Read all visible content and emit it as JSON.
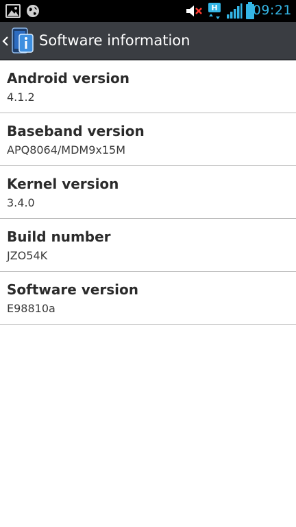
{
  "status_bar": {
    "time": "09:21",
    "network_type": "H",
    "accent_color": "#34b6e6",
    "left_icons": [
      "gallery-icon",
      "globe-icon"
    ],
    "right_icons": [
      "volume-mute-icon",
      "network-h-icon",
      "signal-icon",
      "battery-icon"
    ]
  },
  "action_bar": {
    "title": "Software information",
    "back_icon": "chevron-left-icon",
    "app_icon": "info-device-icon",
    "background": "#3a3d42"
  },
  "items": [
    {
      "title": "Android version",
      "value": "4.1.2"
    },
    {
      "title": "Baseband version",
      "value": "APQ8064/MDM9x15M"
    },
    {
      "title": "Kernel version",
      "value": "3.4.0"
    },
    {
      "title": "Build number",
      "value": "JZO54K"
    },
    {
      "title": "Software version",
      "value": "E98810a"
    }
  ]
}
